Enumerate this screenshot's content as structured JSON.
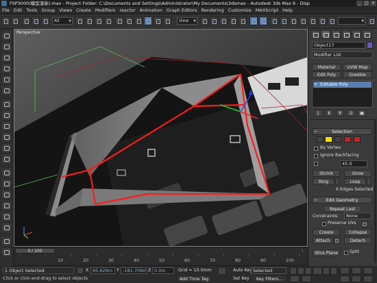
{
  "window": {
    "title": "FSP3000(模型渲染).max - Project Folder: C:\\Documents and Settings\\Administrator\\My Documents\\3dsmax - Autodesk 3ds Max 9 - Disp"
  },
  "menu": [
    "File",
    "Edit",
    "Tools",
    "Group",
    "Views",
    "Create",
    "Modifiers",
    "reactor",
    "Animation",
    "Graph Editors",
    "Rendering",
    "Customize",
    "MAXScript",
    "Help"
  ],
  "toolbar": {
    "selection_filter": "All",
    "ref_coord": "View"
  },
  "viewport": {
    "label": "Perspective"
  },
  "command_panel": {
    "object_name": "Object17",
    "modifier_list": "Modifier List",
    "mod_buttons": [
      "Material",
      "UVW Map",
      "Edit Poly",
      "Greeble"
    ],
    "stack_item": "Editable Poly",
    "selection": {
      "header": "Selection",
      "by_vertex": "By Vertex",
      "ignore_backfacing": "Ignore Backfacing",
      "threshold_value": "45.0",
      "shrink": "Shrink",
      "grow": "Grow",
      "ring": "Ring",
      "loop": "Loop",
      "status": "6 Edges Selected"
    },
    "edit_geometry": {
      "header": "Edit Geometry",
      "repeat_last": "Repeat Last",
      "constraints_label": "Constraints:",
      "constraints_value": "None",
      "preserve_uvs": "Preserve UVs",
      "create": "Create",
      "collapse": "Collapse",
      "attach": "Attach",
      "detach": "Detach",
      "slice_plane": "Slice Plane",
      "split": "Split"
    }
  },
  "timeline": {
    "frame_display": "0 / 100",
    "ticks": [
      "10",
      "20",
      "30",
      "40",
      "50",
      "60",
      "70",
      "80",
      "90",
      "100"
    ]
  },
  "status": {
    "selection_count": "1 Object Selected",
    "prompt": "Click or click-and-drag to select objects",
    "x_value": "85.629m",
    "y_value": "-181.709m",
    "z_value": "0.0m",
    "grid": "Grid = 10.0mm",
    "add_time_tag": "Add Time Tag",
    "auto_key": "Auto Key",
    "set_key": "Set Key",
    "key_mode": "Selected",
    "key_filters": "Key Filters..."
  },
  "colors": {
    "accent": "#5a7fae",
    "selected_edge": "#ff1a1a",
    "background": "#2b2b2b"
  }
}
